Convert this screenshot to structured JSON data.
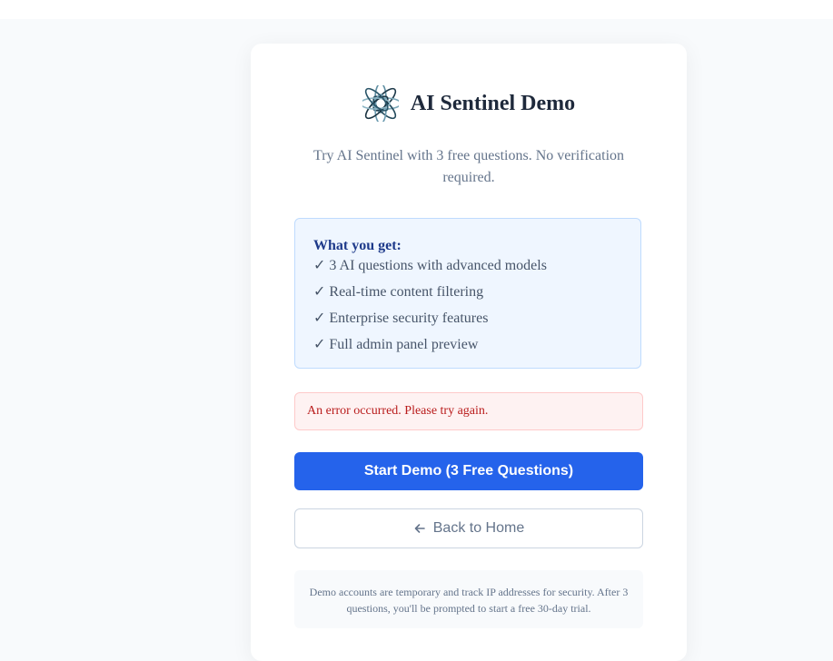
{
  "brand": {
    "title": "AI Sentinel Demo",
    "logo_icon": "flower-swirl-logo"
  },
  "subtitle": "Try AI Sentinel with 3 free questions. No verification required.",
  "features": {
    "heading": "What you get:",
    "items": [
      "✓ 3 AI questions with advanced models",
      "✓ Real-time content filtering",
      "✓ Enterprise security features",
      "✓ Full admin panel preview"
    ]
  },
  "error": {
    "message": "An error occurred. Please try again."
  },
  "actions": {
    "start_demo_label": "Start Demo (3 Free Questions)",
    "back_home_label": "Back to Home",
    "back_icon": "arrow-left-icon"
  },
  "note": "Demo accounts are temporary and track IP addresses for security. After 3 questions, you'll be prompted to start a free 30-day trial.",
  "colors": {
    "primary": "#2563eb",
    "heading": "#1e293b",
    "info_bg": "#eff6ff",
    "info_border": "#bfdbfe",
    "info_heading": "#1e3a8a",
    "error_bg": "#fef2f2",
    "error_border": "#fecaca",
    "error_text": "#b91c1c",
    "muted_text": "#64748b",
    "page_bg": "#f8fafc"
  }
}
